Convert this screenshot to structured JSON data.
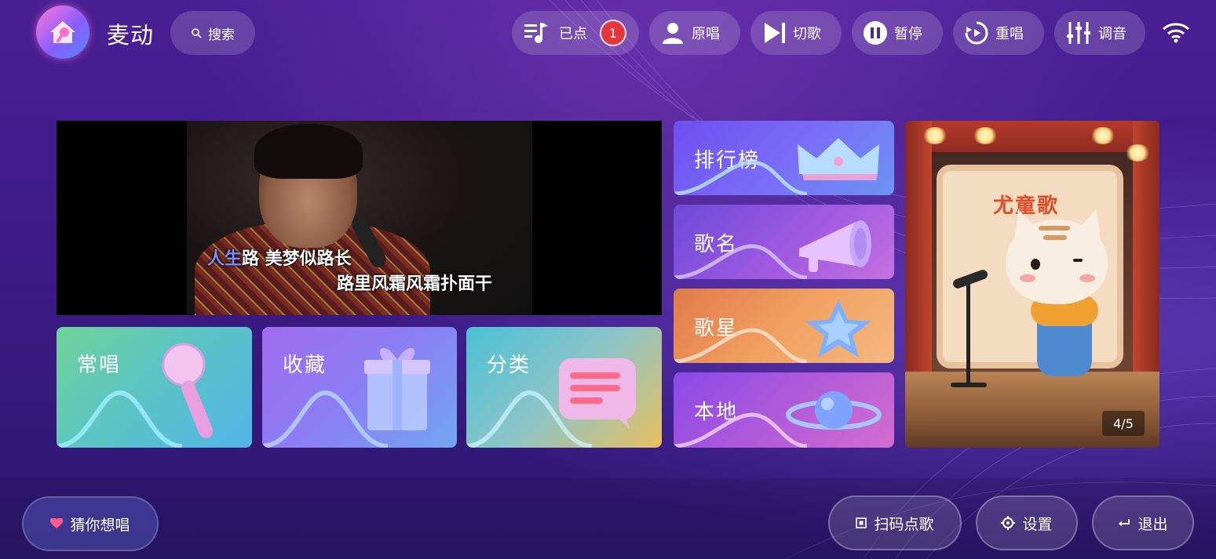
{
  "app": {
    "title": "麦动"
  },
  "header": {
    "search_label": "搜索",
    "buttons": [
      {
        "label": "已点",
        "icon": "queue-music-icon",
        "badge": "1"
      },
      {
        "label": "原唱",
        "icon": "person-icon"
      },
      {
        "label": "切歌",
        "icon": "skip-next-icon"
      },
      {
        "label": "暂停",
        "icon": "pause-icon"
      },
      {
        "label": "重唱",
        "icon": "replay-icon"
      },
      {
        "label": "调音",
        "icon": "equalizer-icon"
      }
    ],
    "status_icon": "wifi-icon"
  },
  "video": {
    "lyric_line1_highlight": "人生",
    "lyric_line1_rest": "路 美梦似路长",
    "lyric_line2": "路里风霜风霜扑面干"
  },
  "tiles": {
    "changchang": "常唱",
    "shoucang": "收藏",
    "fenlei": "分类",
    "paihangbang": "排行榜",
    "geming": "歌名",
    "gexing": "歌星",
    "bendi": "本地"
  },
  "banner": {
    "poster_title": "尤童歌",
    "counter": "4/5"
  },
  "footer": {
    "guess_label": "猜你想唱",
    "scan_label": "扫码点歌",
    "settings_label": "设置",
    "exit_label": "退出"
  },
  "colors": {
    "accent": "#7b8cff",
    "badge": "#e5353d",
    "background": "#3d1b86"
  }
}
